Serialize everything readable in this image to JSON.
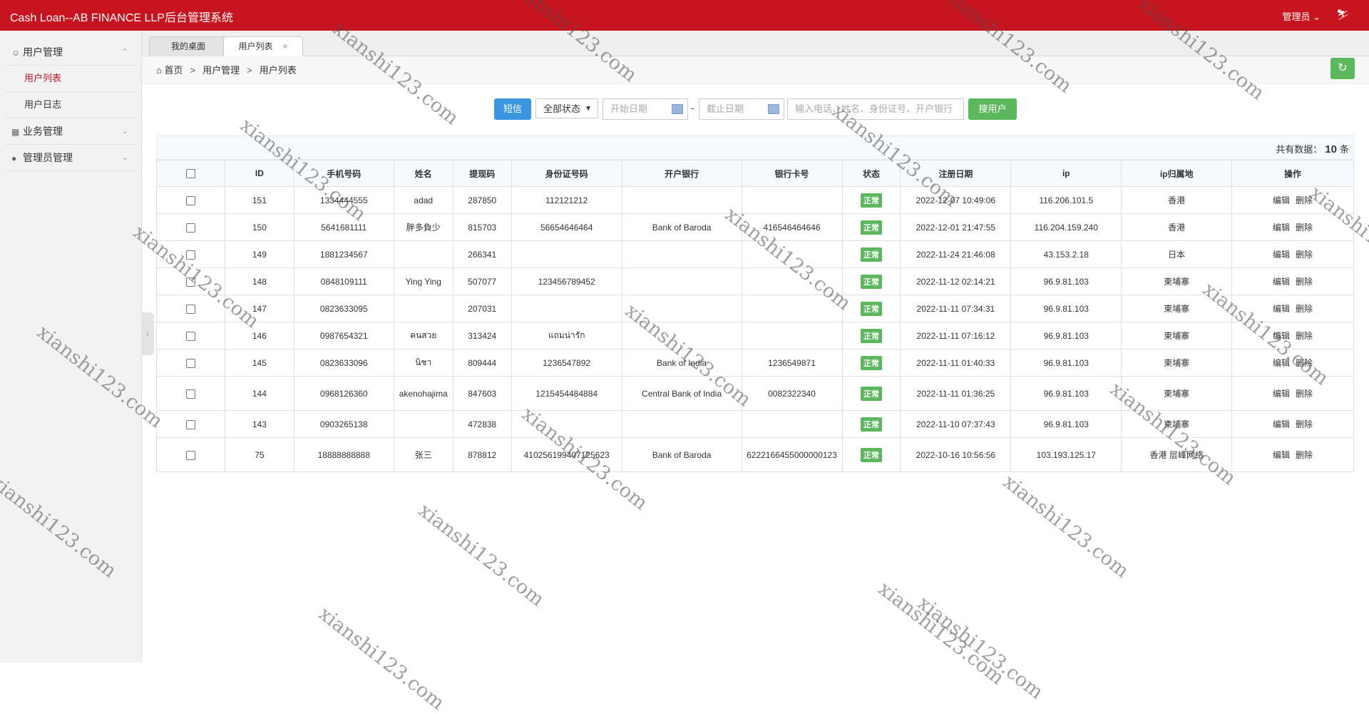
{
  "header": {
    "title": "Cash Loan--AB FINANCE LLP后台管理系统",
    "admin": "管理员",
    "admin_chevron": "chevron-down-icon",
    "skin_icon": "shirt-icon"
  },
  "sidebar": {
    "groups": [
      {
        "label": "用户管理",
        "icon": "user-icon",
        "expanded": true,
        "items": [
          {
            "label": "用户列表",
            "active": true
          },
          {
            "label": "用户日志",
            "active": false
          }
        ]
      },
      {
        "label": "业务管理",
        "icon": "briefcase-icon",
        "expanded": false
      },
      {
        "label": "管理员管理",
        "icon": "admin-icon",
        "expanded": false
      }
    ]
  },
  "tabs": [
    {
      "label": "我的桌面"
    },
    {
      "label": "用户列表",
      "closable": true,
      "close": "×"
    }
  ],
  "breadcrumb": {
    "home": "首页",
    "level1": "用户管理",
    "level2": "用户列表",
    "separator": ">"
  },
  "search": {
    "sms_label": "短信",
    "status_select": "全部状态",
    "start_date_placeholder": "开始日期",
    "dash": "-",
    "end_date_placeholder": "截止日期",
    "keyword_placeholder": "输入电话、姓名、身份证号、开户银行",
    "search_label": "搜用户"
  },
  "count": {
    "prefix": "共有数据：",
    "value": "10",
    "suffix": "条"
  },
  "table": {
    "headers": [
      "ID",
      "手机号码",
      "姓名",
      "提现码",
      "身份证号码",
      "开户银行",
      "银行卡号",
      "状态",
      "注册日期",
      "ip",
      "ip归属地",
      "操作"
    ],
    "edit_label": "编辑",
    "delete_label": "删除",
    "rows": [
      {
        "id": "151",
        "phone": "1334444555",
        "name": "adad",
        "code": "287850",
        "idcard": "112121212",
        "bank": "",
        "card": "",
        "status": "正常",
        "date": "2022-12-07 10:49:06",
        "ip": "116.206.101.5",
        "loc": "香港"
      },
      {
        "id": "150",
        "phone": "5641681111",
        "name": "胖多負少",
        "code": "815703",
        "idcard": "56654646464",
        "bank": "Bank of Baroda",
        "card": "416546464646",
        "status": "正常",
        "date": "2022-12-01 21:47:55",
        "ip": "116.204.159.240",
        "loc": "香港"
      },
      {
        "id": "149",
        "phone": "1881234567",
        "name": "",
        "code": "266341",
        "idcard": "",
        "bank": "",
        "card": "",
        "status": "正常",
        "date": "2022-11-24 21:46:08",
        "ip": "43.153.2.18",
        "loc": "日本"
      },
      {
        "id": "148",
        "phone": "0848109111",
        "name": "Ying Ying",
        "code": "507077",
        "idcard": "123456789452",
        "bank": "",
        "card": "",
        "status": "正常",
        "date": "2022-11-12 02:14:21",
        "ip": "96.9.81.103",
        "loc": "柬埔寨"
      },
      {
        "id": "147",
        "phone": "0823633095",
        "name": "",
        "code": "207031",
        "idcard": "",
        "bank": "",
        "card": "",
        "status": "正常",
        "date": "2022-11-11 07:34:31",
        "ip": "96.9.81.103",
        "loc": "柬埔寨"
      },
      {
        "id": "146",
        "phone": "0987654321",
        "name": "คนสวย",
        "code": "313424",
        "idcard": "แถมน่ารัก",
        "bank": "",
        "card": "",
        "status": "正常",
        "date": "2022-11-11 07:16:12",
        "ip": "96.9.81.103",
        "loc": "柬埔寨"
      },
      {
        "id": "145",
        "phone": "0823633096",
        "name": "นิชา",
        "code": "809444",
        "idcard": "1236547892",
        "bank": "Bank of India",
        "card": "1236549871",
        "status": "正常",
        "date": "2022-11-11 01:40:33",
        "ip": "96.9.81.103",
        "loc": "柬埔寨"
      },
      {
        "id": "144",
        "phone": "0968126360",
        "name": "akenohajima",
        "code": "847603",
        "idcard": "1215454484884",
        "bank": "Central Bank of India",
        "card": "0082322340",
        "status": "正常",
        "date": "2022-11-11 01:36:25",
        "ip": "96.9.81.103",
        "loc": "柬埔寨",
        "tall": true
      },
      {
        "id": "143",
        "phone": "0903265138",
        "name": "",
        "code": "472838",
        "idcard": "",
        "bank": "",
        "card": "",
        "status": "正常",
        "date": "2022-11-10 07:37:43",
        "ip": "96.9.81.103",
        "loc": "柬埔寨"
      },
      {
        "id": "75",
        "phone": "18888888888",
        "name": "张三",
        "code": "878812",
        "idcard": "410256199407125623",
        "bank": "Bank of Baroda",
        "card": "6222166455000000123",
        "status": "正常",
        "date": "2022-10-16 10:56:56",
        "ip": "103.193.125.17",
        "loc": "香港 层峰网络",
        "tall": true
      }
    ]
  },
  "watermark": "xianshi123.com"
}
